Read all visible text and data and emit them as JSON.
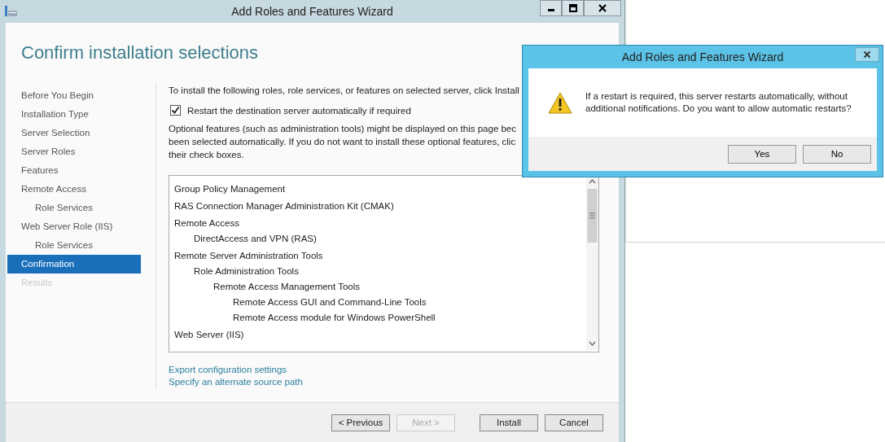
{
  "main_window": {
    "title": "Add Roles and Features Wizard",
    "heading": "Confirm installation selections",
    "steps": [
      {
        "label": "Before You Begin",
        "selected": false,
        "disabled": false
      },
      {
        "label": "Installation Type",
        "selected": false,
        "disabled": false
      },
      {
        "label": "Server Selection",
        "selected": false,
        "disabled": false
      },
      {
        "label": "Server Roles",
        "selected": false,
        "disabled": false
      },
      {
        "label": "Features",
        "selected": false,
        "disabled": false
      },
      {
        "label": "Remote Access",
        "selected": false,
        "disabled": false,
        "children": [
          {
            "label": "Role Services",
            "selected": false,
            "disabled": false
          }
        ]
      },
      {
        "label": "Web Server Role (IIS)",
        "selected": false,
        "disabled": false,
        "children": [
          {
            "label": "Role Services",
            "selected": false,
            "disabled": false
          }
        ]
      },
      {
        "label": "Confirmation",
        "selected": true,
        "disabled": false
      },
      {
        "label": "Results",
        "selected": false,
        "disabled": true
      }
    ],
    "intro": "To install the following roles, role services, or features on selected server, click Install",
    "restart_checkbox": {
      "label": "Restart the destination server automatically if required",
      "checked": true
    },
    "note": "Optional features (such as administration tools) might be displayed on this page bec\nbeen selected automatically. If you do not want to install these optional features, clic\ntheir check boxes.",
    "features": [
      {
        "label": "Group Policy Management"
      },
      {
        "label": "RAS Connection Manager Administration Kit (CMAK)"
      },
      {
        "label": "Remote Access",
        "children": [
          {
            "label": "DirectAccess and VPN (RAS)"
          }
        ]
      },
      {
        "label": "Remote Server Administration Tools",
        "children": [
          {
            "label": "Role Administration Tools",
            "children": [
              {
                "label": "Remote Access Management Tools",
                "children": [
                  {
                    "label": "Remote Access GUI and Command-Line Tools"
                  },
                  {
                    "label": "Remote Access module for Windows PowerShell"
                  }
                ]
              }
            ]
          }
        ]
      },
      {
        "label": "Web Server (IIS)"
      }
    ],
    "links": [
      "Export configuration settings",
      "Specify an alternate source path"
    ],
    "buttons": [
      {
        "label": "< Previous",
        "disabled": false
      },
      {
        "label": "Next >",
        "disabled": true
      },
      {
        "label": "Install",
        "disabled": false
      },
      {
        "label": "Cancel",
        "disabled": false
      }
    ]
  },
  "dialog": {
    "title": "Add Roles and Features Wizard",
    "message": "If a restart is required, this server restarts automatically, without additional notifications. Do you want to allow automatic restarts?",
    "buttons": [
      "Yes",
      "No"
    ]
  }
}
